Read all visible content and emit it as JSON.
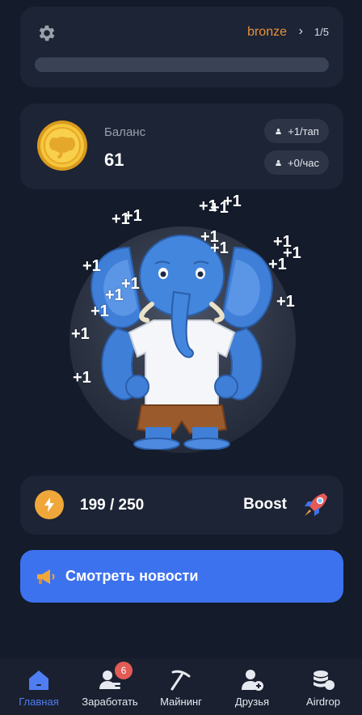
{
  "header": {
    "league": "bronze",
    "level": "1/5",
    "progress_fraction": 0.0
  },
  "balance": {
    "label": "Баланс",
    "value": "61",
    "per_tap": "+1/тап",
    "per_hour": "+0/час"
  },
  "tap_area": {
    "floating_text": "+1"
  },
  "energy": {
    "value": "199 / 250",
    "boost_label": "Boost"
  },
  "news": {
    "label": "Смотреть новости"
  },
  "nav": {
    "items": [
      {
        "label": "Главная",
        "icon": "home-icon",
        "active": true
      },
      {
        "label": "Заработать",
        "icon": "earn-icon",
        "badge": "6"
      },
      {
        "label": "Майнинг",
        "icon": "pickaxe-icon"
      },
      {
        "label": "Друзья",
        "icon": "add-friend-icon"
      },
      {
        "label": "Airdrop",
        "icon": "coins-icon"
      }
    ]
  },
  "colors": {
    "background": "#141b2b",
    "card": "#1c2435",
    "accent_blue": "#3d72ee",
    "league_orange": "#e8913a",
    "badge_red": "#e35b55"
  }
}
